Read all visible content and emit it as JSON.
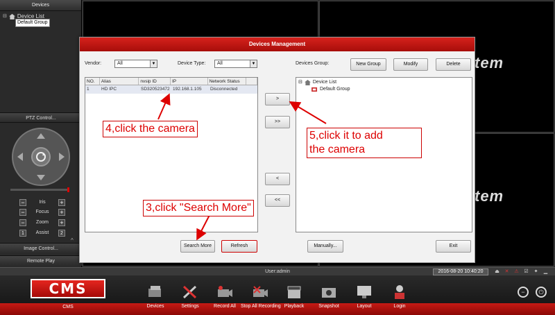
{
  "left_panel": {
    "header": "Devices",
    "tree_root": "Device List",
    "tree_group": "Default Group",
    "ptz_header": "PTZ Control...",
    "ptz_controls": [
      {
        "label": "Iris",
        "minus": "−",
        "plus": "+"
      },
      {
        "label": "Focus",
        "minus": "−",
        "plus": "+"
      },
      {
        "label": "Zoom",
        "minus": "−",
        "plus": "+"
      },
      {
        "label": "Assist",
        "minus": "1",
        "plus": "2"
      }
    ],
    "image_control": "Image Control...",
    "remote_play": "Remote Play",
    "collapse": "^"
  },
  "video": {
    "overlay_text": "tem"
  },
  "dialog": {
    "title": "Devices Management",
    "vendor_label": "Vendor:",
    "vendor_value": "All",
    "type_label": "Device Type:",
    "type_value": "All",
    "group_label": "Devices Group:",
    "new_group": "New Group",
    "modify": "Modify",
    "delete": "Delete",
    "table": {
      "headers": [
        "NO.",
        "Alias",
        "nvsip ID",
        "IP",
        "Network Status"
      ],
      "rows": [
        [
          "1",
          "HD IPC",
          "SD320523472",
          "192.168.1.105",
          "Disconnected"
        ]
      ]
    },
    "tree_root": "Device List",
    "tree_group": "Default Group",
    "add_one": ">",
    "add_all": ">>",
    "remove_one": "<",
    "remove_all": "<<",
    "search_more": "Search More",
    "refresh": "Refresh",
    "manually": "Manually...",
    "exit": "Exit"
  },
  "annotations": {
    "step4": "4,click the camera",
    "step5_line1": "5,click  it  to  add",
    "step5_line2": "the camera",
    "step3": "3,click \"Search More\""
  },
  "status": {
    "user": "User:admin",
    "datetime": "2016-08-20 10:40:20"
  },
  "toolbar": {
    "logo": "CMS",
    "logo_label": "CMS",
    "items": [
      "Devices",
      "Settings",
      "Record All",
      "Stop All Recording",
      "Playback",
      "Snapshot",
      "Layout",
      "Login"
    ]
  },
  "colors": {
    "accent": "#c51a14",
    "annotation": "#d00000"
  }
}
